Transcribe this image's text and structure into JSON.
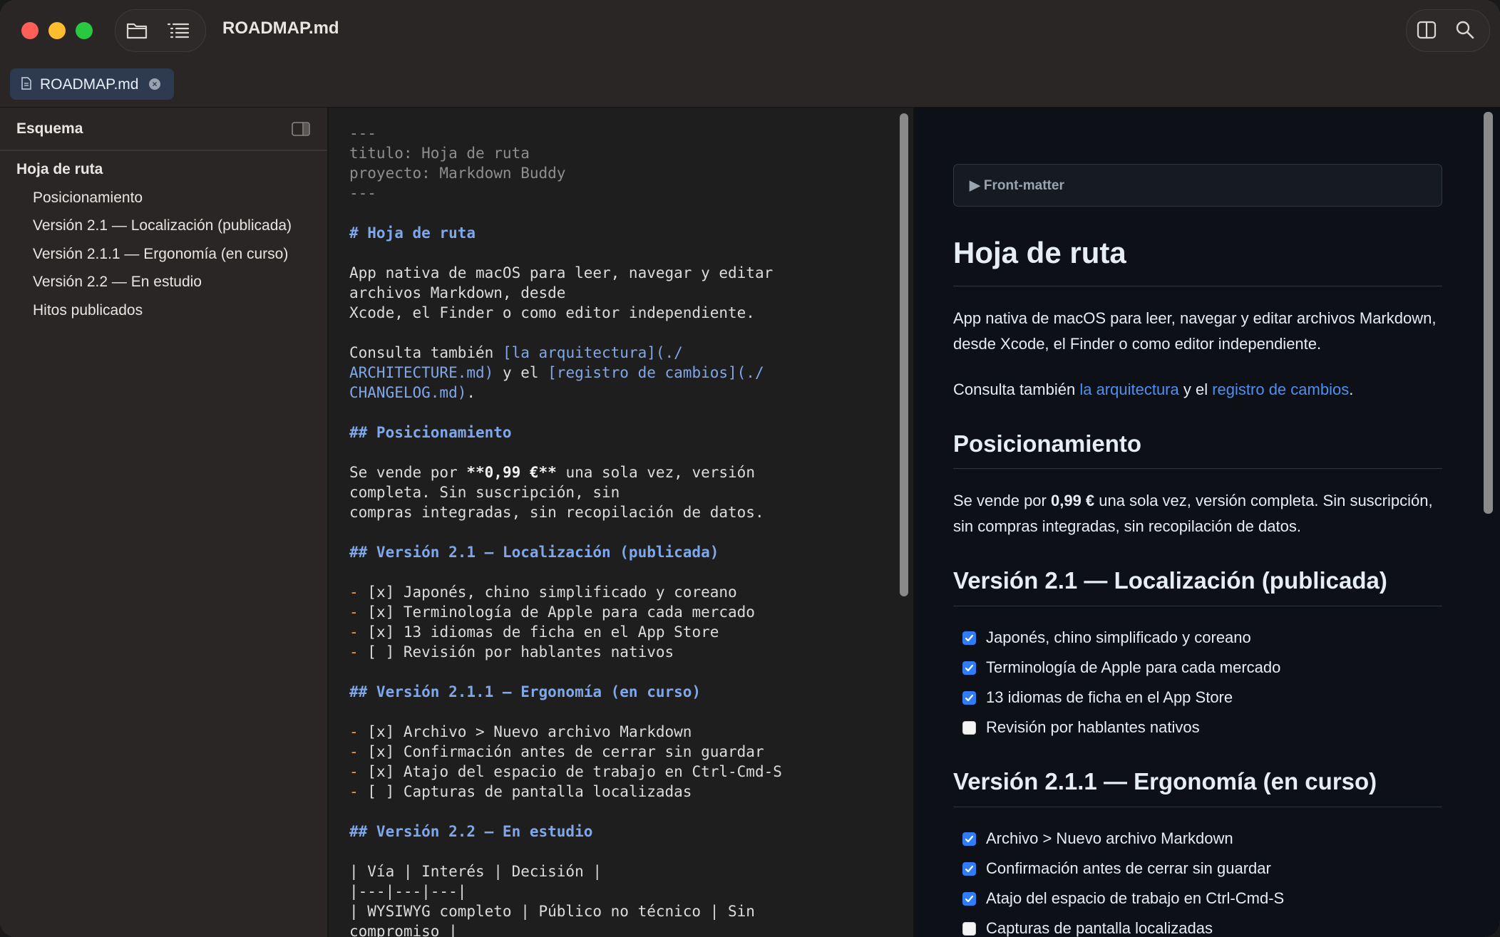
{
  "window": {
    "title": "ROADMAP.md"
  },
  "tab": {
    "label": "ROADMAP.md"
  },
  "sidebar": {
    "header": "Esquema",
    "items": [
      {
        "label": "Hoja de ruta",
        "level": 1
      },
      {
        "label": "Posicionamiento",
        "level": 2
      },
      {
        "label": "Versión 2.1 — Localización (publicada)",
        "level": 2
      },
      {
        "label": "Versión 2.1.1 — Ergonomía (en curso)",
        "level": 2
      },
      {
        "label": "Versión 2.2 — En estudio",
        "level": 2
      },
      {
        "label": "Hitos publicados",
        "level": 2
      }
    ]
  },
  "editor": {
    "lines": [
      {
        "t": "dim",
        "s": "---"
      },
      {
        "t": "dim",
        "s": "titulo: Hoja de ruta"
      },
      {
        "t": "dim",
        "s": "proyecto: Markdown Buddy"
      },
      {
        "t": "dim",
        "s": "---"
      },
      {
        "t": "blank",
        "s": ""
      },
      {
        "t": "head",
        "s": "# Hoja de ruta"
      },
      {
        "t": "blank",
        "s": ""
      },
      {
        "t": "text",
        "s": "App nativa de macOS para leer, navegar y editar"
      },
      {
        "t": "text",
        "s": "archivos Markdown, desde"
      },
      {
        "t": "text",
        "s": "Xcode, el Finder o como editor independiente."
      },
      {
        "t": "blank",
        "s": ""
      },
      {
        "t": "rich",
        "parts": [
          {
            "c": "text",
            "s": "Consulta también "
          },
          {
            "c": "link",
            "s": "[la arquitectura](./"
          }
        ]
      },
      {
        "t": "rich",
        "parts": [
          {
            "c": "link",
            "s": "ARCHITECTURE.md)"
          },
          {
            "c": "text",
            "s": " y el "
          },
          {
            "c": "link",
            "s": "[registro de cambios](./"
          }
        ]
      },
      {
        "t": "rich",
        "parts": [
          {
            "c": "link",
            "s": "CHANGELOG.md)"
          },
          {
            "c": "text",
            "s": "."
          }
        ]
      },
      {
        "t": "blank",
        "s": ""
      },
      {
        "t": "head",
        "s": "## Posicionamiento"
      },
      {
        "t": "blank",
        "s": ""
      },
      {
        "t": "rich",
        "parts": [
          {
            "c": "text",
            "s": "Se vende por "
          },
          {
            "c": "bold",
            "s": "**0,99 €**"
          },
          {
            "c": "text",
            "s": " una sola vez, versión"
          }
        ]
      },
      {
        "t": "text",
        "s": "completa. Sin suscripción, sin"
      },
      {
        "t": "text",
        "s": "compras integradas, sin recopilación de datos."
      },
      {
        "t": "blank",
        "s": ""
      },
      {
        "t": "head",
        "s": "## Versión 2.1 — Localización (publicada)"
      },
      {
        "t": "blank",
        "s": ""
      },
      {
        "t": "list",
        "s": "[x] Japonés, chino simplificado y coreano"
      },
      {
        "t": "list",
        "s": "[x] Terminología de Apple para cada mercado"
      },
      {
        "t": "list",
        "s": "[x] 13 idiomas de ficha en el App Store"
      },
      {
        "t": "list",
        "s": "[ ] Revisión por hablantes nativos"
      },
      {
        "t": "blank",
        "s": ""
      },
      {
        "t": "head",
        "s": "## Versión 2.1.1 — Ergonomía (en curso)"
      },
      {
        "t": "blank",
        "s": ""
      },
      {
        "t": "list",
        "s": "[x] Archivo > Nuevo archivo Markdown"
      },
      {
        "t": "list",
        "s": "[x] Confirmación antes de cerrar sin guardar"
      },
      {
        "t": "list",
        "s": "[x] Atajo del espacio de trabajo en Ctrl-Cmd-S"
      },
      {
        "t": "list",
        "s": "[ ] Capturas de pantalla localizadas"
      },
      {
        "t": "blank",
        "s": ""
      },
      {
        "t": "head",
        "s": "## Versión 2.2 — En estudio"
      },
      {
        "t": "blank",
        "s": ""
      },
      {
        "t": "text",
        "s": "| Vía | Interés | Decisión |"
      },
      {
        "t": "text",
        "s": "|---|---|---|"
      },
      {
        "t": "text",
        "s": "| WYSIWYG completo | Público no técnico | Sin"
      },
      {
        "t": "text",
        "s": "compromiso |"
      }
    ]
  },
  "preview": {
    "front_matter": "▶ Front-matter",
    "h1": "Hoja de ruta",
    "intro": "App nativa de macOS para leer, navegar y editar archivos Markdown, desde Xcode, el Finder o como editor independiente.",
    "see_also": {
      "prefix": "Consulta también ",
      "link1": "la arquitectura",
      "middle": " y el ",
      "link2": "registro de cambios",
      "suffix": "."
    },
    "positioning": {
      "title": "Posicionamiento",
      "prefix": "Se vende por ",
      "price": "0,99 €",
      "suffix": " una sola vez, versión completa. Sin suscripción, sin compras integradas, sin recopilación de datos."
    },
    "v21": {
      "title": "Versión 2.1 — Localización (publicada)",
      "tasks": [
        {
          "label": "Japonés, chino simplificado y coreano",
          "done": true
        },
        {
          "label": "Terminología de Apple para cada mercado",
          "done": true
        },
        {
          "label": "13 idiomas de ficha en el App Store",
          "done": true
        },
        {
          "label": "Revisión por hablantes nativos",
          "done": false
        }
      ]
    },
    "v211": {
      "title": "Versión 2.1.1 — Ergonomía (en curso)",
      "tasks": [
        {
          "label": "Archivo > Nuevo archivo Markdown",
          "done": true
        },
        {
          "label": "Confirmación antes de cerrar sin guardar",
          "done": true
        },
        {
          "label": "Atajo del espacio de trabajo en Ctrl-Cmd-S",
          "done": true
        },
        {
          "label": "Capturas de pantalla localizadas",
          "done": false
        }
      ]
    }
  },
  "colors": {
    "accent": "#2f7cf6",
    "link": "#4f8ff0",
    "editor_heading": "#7fa7ea",
    "editor_list_marker": "#e2a05a"
  }
}
